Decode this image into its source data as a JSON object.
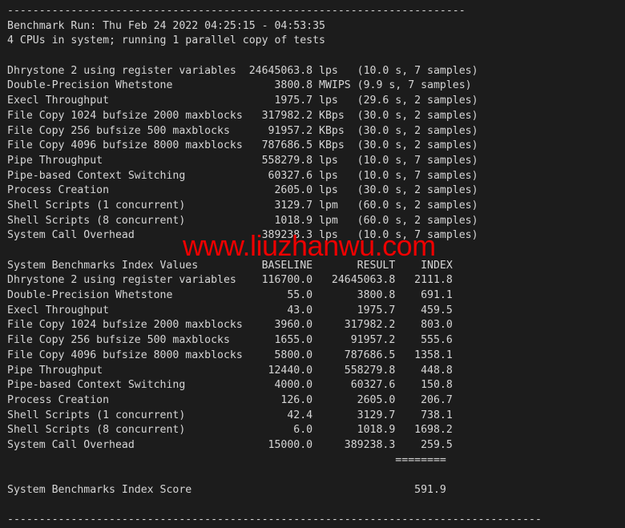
{
  "terminal": {
    "background_color": "#1c1c1c",
    "text_color": "#d6d6d6",
    "top_rule": "------------------------------------------------------------------------",
    "bottom_rule": "------------------------------------------------------------------------------------",
    "header": {
      "run_line": "Benchmark Run: Thu Feb 24 2022 04:25:15 - 04:53:35",
      "cpu_line": "4 CPUs in system; running 1 parallel copy of tests"
    },
    "results": [
      {
        "name": "Dhrystone 2 using register variables",
        "value": "24645063.8",
        "unit": "lps",
        "detail": "(10.0 s, 7 samples)"
      },
      {
        "name": "Double-Precision Whetstone",
        "value": "3800.8",
        "unit": "MWIPS",
        "detail": "(9.9 s, 7 samples)"
      },
      {
        "name": "Execl Throughput",
        "value": "1975.7",
        "unit": "lps",
        "detail": "(29.6 s, 2 samples)"
      },
      {
        "name": "File Copy 1024 bufsize 2000 maxblocks",
        "value": "317982.2",
        "unit": "KBps",
        "detail": "(30.0 s, 2 samples)"
      },
      {
        "name": "File Copy 256 bufsize 500 maxblocks",
        "value": "91957.2",
        "unit": "KBps",
        "detail": "(30.0 s, 2 samples)"
      },
      {
        "name": "File Copy 4096 bufsize 8000 maxblocks",
        "value": "787686.5",
        "unit": "KBps",
        "detail": "(30.0 s, 2 samples)"
      },
      {
        "name": "Pipe Throughput",
        "value": "558279.8",
        "unit": "lps",
        "detail": "(10.0 s, 7 samples)"
      },
      {
        "name": "Pipe-based Context Switching",
        "value": "60327.6",
        "unit": "lps",
        "detail": "(10.0 s, 7 samples)"
      },
      {
        "name": "Process Creation",
        "value": "2605.0",
        "unit": "lps",
        "detail": "(30.0 s, 2 samples)"
      },
      {
        "name": "Shell Scripts (1 concurrent)",
        "value": "3129.7",
        "unit": "lpm",
        "detail": "(60.0 s, 2 samples)"
      },
      {
        "name": "Shell Scripts (8 concurrent)",
        "value": "1018.9",
        "unit": "lpm",
        "detail": "(60.0 s, 2 samples)"
      },
      {
        "name": "System Call Overhead",
        "value": "389238.3",
        "unit": "lps",
        "detail": "(10.0 s, 7 samples)"
      }
    ],
    "index_table": {
      "title": "System Benchmarks Index Values",
      "columns": [
        "BASELINE",
        "RESULT",
        "INDEX"
      ],
      "rows": [
        {
          "name": "Dhrystone 2 using register variables",
          "baseline": "116700.0",
          "result": "24645063.8",
          "index": "2111.8"
        },
        {
          "name": "Double-Precision Whetstone",
          "baseline": "55.0",
          "result": "3800.8",
          "index": "691.1"
        },
        {
          "name": "Execl Throughput",
          "baseline": "43.0",
          "result": "1975.7",
          "index": "459.5"
        },
        {
          "name": "File Copy 1024 bufsize 2000 maxblocks",
          "baseline": "3960.0",
          "result": "317982.2",
          "index": "803.0"
        },
        {
          "name": "File Copy 256 bufsize 500 maxblocks",
          "baseline": "1655.0",
          "result": "91957.2",
          "index": "555.6"
        },
        {
          "name": "File Copy 4096 bufsize 8000 maxblocks",
          "baseline": "5800.0",
          "result": "787686.5",
          "index": "1358.1"
        },
        {
          "name": "Pipe Throughput",
          "baseline": "12440.0",
          "result": "558279.8",
          "index": "448.8"
        },
        {
          "name": "Pipe-based Context Switching",
          "baseline": "4000.0",
          "result": "60327.6",
          "index": "150.8"
        },
        {
          "name": "Process Creation",
          "baseline": "126.0",
          "result": "2605.0",
          "index": "206.7"
        },
        {
          "name": "Shell Scripts (1 concurrent)",
          "baseline": "42.4",
          "result": "3129.7",
          "index": "738.1"
        },
        {
          "name": "Shell Scripts (8 concurrent)",
          "baseline": "6.0",
          "result": "1018.9",
          "index": "1698.2"
        },
        {
          "name": "System Call Overhead",
          "baseline": "15000.0",
          "result": "389238.3",
          "index": "259.5"
        }
      ],
      "separator": "========",
      "score_label": "System Benchmarks Index Score",
      "score_value": "591.9"
    }
  },
  "watermark": {
    "text": "www.liuzhanwu.com",
    "color": "#ee0000"
  }
}
